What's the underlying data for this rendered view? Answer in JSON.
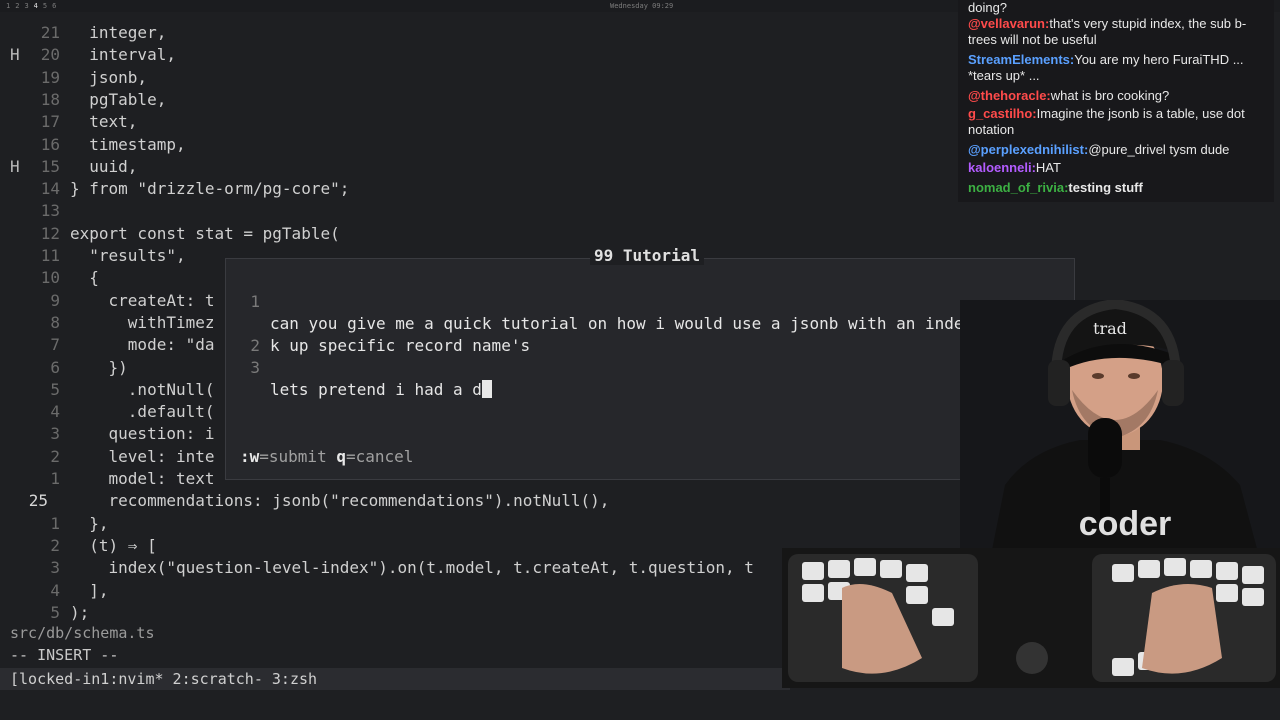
{
  "topbar": {
    "workspaces": [
      "1",
      "2",
      "3",
      "4",
      "5",
      "6"
    ],
    "clock": "Wednesday 09:29"
  },
  "editor": {
    "lines": [
      {
        "sign": "",
        "num": "21",
        "code": "  integer,"
      },
      {
        "sign": "H",
        "num": "20",
        "code": "  interval,"
      },
      {
        "sign": "",
        "num": "19",
        "code": "  jsonb,"
      },
      {
        "sign": "",
        "num": "18",
        "code": "  pgTable,"
      },
      {
        "sign": "",
        "num": "17",
        "code": "  text,"
      },
      {
        "sign": "",
        "num": "16",
        "code": "  timestamp,"
      },
      {
        "sign": "H",
        "num": "15",
        "code": "  uuid,"
      },
      {
        "sign": "",
        "num": "14",
        "code": "} from \"drizzle-orm/pg-core\";"
      },
      {
        "sign": "",
        "num": "13",
        "code": ""
      },
      {
        "sign": "",
        "num": "12",
        "code": "export const stat = pgTable("
      },
      {
        "sign": "",
        "num": "11",
        "code": "  \"results\","
      },
      {
        "sign": "",
        "num": "10",
        "code": "  {"
      },
      {
        "sign": "",
        "num": "9",
        "code": "    createAt: t"
      },
      {
        "sign": "",
        "num": "8",
        "code": "      withTimez"
      },
      {
        "sign": "",
        "num": "7",
        "code": "      mode: \"da"
      },
      {
        "sign": "",
        "num": "6",
        "code": "    })"
      },
      {
        "sign": "",
        "num": "5",
        "code": "      .notNull("
      },
      {
        "sign": "",
        "num": "4",
        "code": "      .default("
      },
      {
        "sign": "",
        "num": "3",
        "code": "    question: i"
      },
      {
        "sign": "",
        "num": "2",
        "code": "    level: inte"
      },
      {
        "sign": "",
        "num": "1",
        "code": "    model: text"
      },
      {
        "sign": "",
        "num": "25",
        "code": "    recommendations: jsonb(\"recommendations\").notNull(),",
        "current": true
      },
      {
        "sign": "",
        "num": "1",
        "code": "  },"
      },
      {
        "sign": "",
        "num": "2",
        "code": "  (t) ⇒ ["
      },
      {
        "sign": "",
        "num": "3",
        "code": "    index(\"question-level-index\").on(t.model, t.createAt, t.question, t"
      },
      {
        "sign": "",
        "num": "4",
        "code": "  ],"
      },
      {
        "sign": "",
        "num": "5",
        "code": ");"
      }
    ],
    "file_path": "src/db/schema.ts",
    "mode": "-- INSERT --",
    "tmux_status": "[locked-in1:nvim* 2:scratch- 3:zsh"
  },
  "popup": {
    "title": "99 Tutorial",
    "lines": [
      {
        "num": "1",
        "text": "can you give me a quick tutorial on how i would use a jsonb with an index to loo"
      },
      {
        "num": "",
        "text": "k up specific record name's"
      },
      {
        "num": "2",
        "text": ""
      },
      {
        "num": "3",
        "text": "lets pretend i had a d"
      }
    ],
    "help_submit_key": ":w",
    "help_submit_label": "=submit",
    "help_cancel_key": "q",
    "help_cancel_label": "=cancel"
  },
  "chat": {
    "messages": [
      {
        "user": "",
        "color": "#e8e8e8",
        "text": "doing?"
      },
      {
        "user": "@vellavarun:",
        "color": "#ff4b4b",
        "text": "that's very stupid index, the sub b-trees will not be useful"
      },
      {
        "user": "StreamElements:",
        "color": "#5aa0ff",
        "text": "You are my hero FuraiTHD ... *tears up* ..."
      },
      {
        "user": "@thehoracle:",
        "color": "#ff4b4b",
        "text": "what is bro cooking?"
      },
      {
        "user": "g_castilho:",
        "color": "#ff4b4b",
        "text": "Imagine the jsonb is a table, use dot notation"
      },
      {
        "user": "@perplexednihilist:",
        "color": "#5aa0ff",
        "text": "@pure_drivel tysm dude"
      },
      {
        "user": "kaloenneli:",
        "color": "#b35cff",
        "text": "HAT"
      },
      {
        "user": "nomad_of_rivia:",
        "color": "#3cb043",
        "text": "testing stuff"
      }
    ]
  },
  "webcam": {
    "cap_text": "trad",
    "shirt_text": "coder"
  }
}
